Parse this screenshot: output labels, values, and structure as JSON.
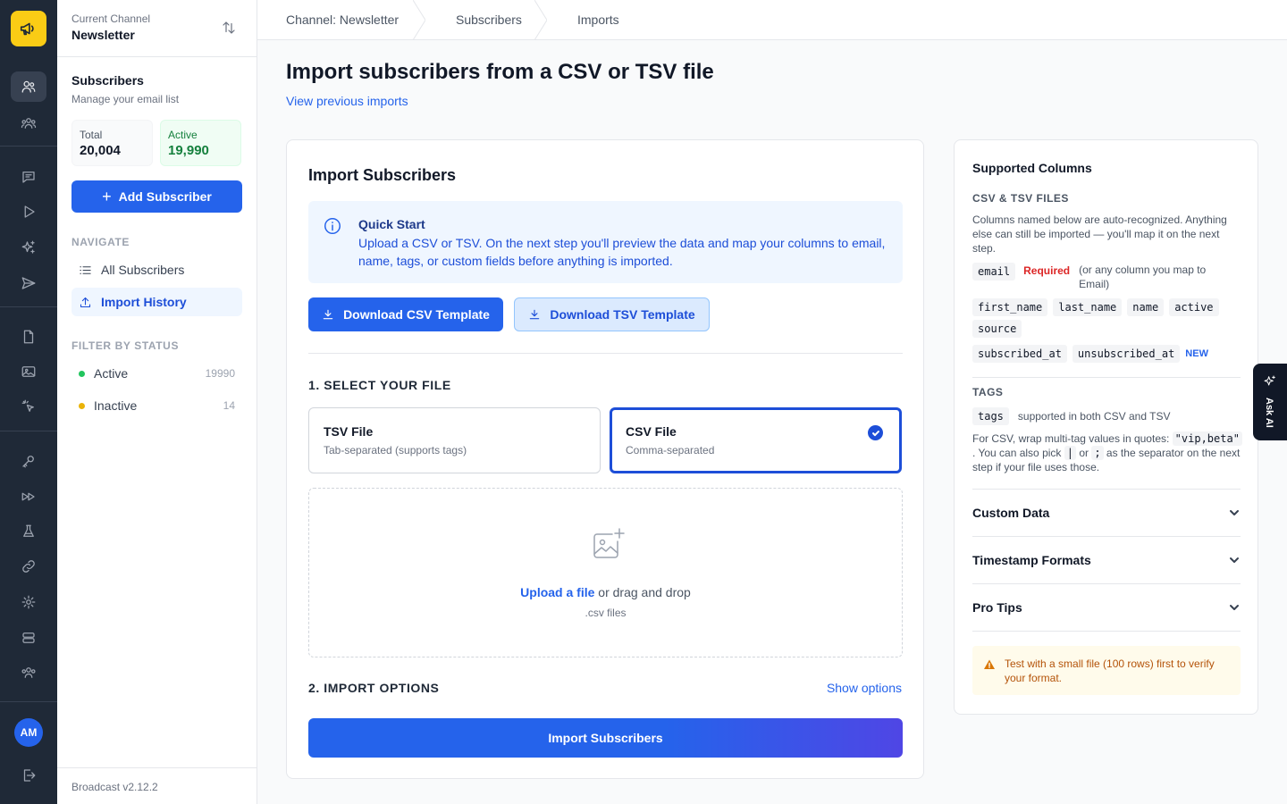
{
  "rail": {
    "avatar_initials": "AM",
    "brand_color": "#facc15",
    "icons": [
      "megaphone-icon",
      "users-icon",
      "groups-icon",
      "chat-icon",
      "play-icon",
      "sparkles-icon",
      "send-icon",
      "file-icon",
      "image-icon",
      "cursor-click-icon",
      "key-icon",
      "fast-forward-icon",
      "flask-icon",
      "link-icon",
      "gear-icon",
      "database-icon",
      "team-icon",
      "logout-icon"
    ]
  },
  "sidebar": {
    "channel_label": "Current Channel",
    "channel_name": "Newsletter",
    "section_title": "Subscribers",
    "section_subtitle": "Manage your email list",
    "stats": {
      "total_label": "Total",
      "total_value": "20,004",
      "active_label": "Active",
      "active_value": "19,990"
    },
    "add_button": "Add Subscriber",
    "navigate_heading": "NAVIGATE",
    "nav_items": [
      {
        "label": "All Subscribers"
      },
      {
        "label": "Import History"
      }
    ],
    "filter_heading": "FILTER BY STATUS",
    "filters": [
      {
        "label": "Active",
        "count": "19990",
        "color": "#22c55e"
      },
      {
        "label": "Inactive",
        "count": "14",
        "color": "#eab308"
      }
    ],
    "version": "Broadcast v2.12.2"
  },
  "breadcrumb": [
    "Channel: Newsletter",
    "Subscribers",
    "Imports"
  ],
  "page": {
    "title": "Import subscribers from a CSV or TSV file",
    "previous_link": "View previous imports"
  },
  "import_card": {
    "title": "Import Subscribers",
    "quick_start_title": "Quick Start",
    "quick_start_text": "Upload a CSV or TSV. On the next step you'll preview the data and map your columns to email, name, tags, or custom fields before anything is imported.",
    "download_csv": "Download CSV Template",
    "download_tsv": "Download TSV Template",
    "step1_heading": "1. SELECT YOUR FILE",
    "file_types": [
      {
        "name": "TSV File",
        "desc": "Tab-separated (supports tags)",
        "selected": false
      },
      {
        "name": "CSV File",
        "desc": "Comma-separated",
        "selected": true
      }
    ],
    "upload_link": "Upload a file",
    "upload_rest": " or drag and drop",
    "upload_hint": ".csv files",
    "step2_heading": "2. IMPORT OPTIONS",
    "show_options": "Show options",
    "import_button": "Import Subscribers"
  },
  "supported": {
    "title": "Supported Columns",
    "files_heading": "CSV & TSV FILES",
    "files_text": "Columns named below are auto-recognized. Anything else can still be imported — you'll map it on the next step.",
    "email_chip": "email",
    "required_label": "Required",
    "email_note": "(or any column you map to Email)",
    "chips_row1": [
      "first_name",
      "last_name",
      "name",
      "active"
    ],
    "chips_row2": [
      "source"
    ],
    "chips_row3": [
      "subscribed_at",
      "unsubscribed_at"
    ],
    "new_badge": "NEW",
    "tags_heading": "TAGS",
    "tags_chip": "tags",
    "tags_note": "supported in both CSV and TSV",
    "tags_text_1": "For CSV, wrap multi-tag values in quotes:",
    "tags_code_1": "\"vip,beta\"",
    "tags_text_2": ". You can also pick",
    "tags_code_2": "|",
    "tags_text_3": "or",
    "tags_code_3": ";",
    "tags_text_4": "as the separator on the next step if your file uses those.",
    "accordions": [
      "Custom Data",
      "Timestamp Formats",
      "Pro Tips"
    ],
    "warning": "Test with a small file (100 rows) first to verify your format."
  },
  "ask_ai": "Ask AI"
}
